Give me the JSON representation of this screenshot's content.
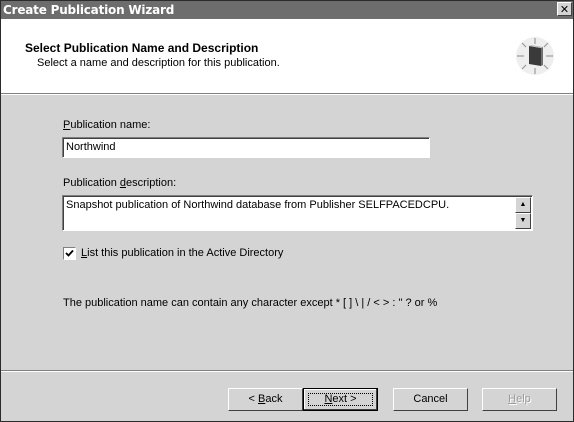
{
  "window": {
    "title": "Create Publication Wizard",
    "close_glyph": "✕"
  },
  "header": {
    "title": "Select Publication Name and Description",
    "subtitle": "Select a name and description for this publication.",
    "icon": "wizard-book-icon"
  },
  "form": {
    "name_label_accel": "P",
    "name_label_rest": "ublication name:",
    "name_value": "Northwind",
    "desc_label_pre": "Publication ",
    "desc_label_accel": "d",
    "desc_label_rest": "escription:",
    "desc_value": "Snapshot publication of Northwind database from Publisher SELFPACEDCPU.",
    "checkbox_accel": "L",
    "checkbox_rest": "ist this publication in the Active Directory",
    "checkbox_checked": true,
    "note": "The publication name can contain any character except * [ ] \\ | / < > : \" ? or %"
  },
  "buttons": {
    "back_pre": "< ",
    "back_accel": "B",
    "back_rest": "ack",
    "next_accel": "N",
    "next_rest": "ext >",
    "cancel": "Cancel",
    "help_accel": "H",
    "help_rest": "elp"
  }
}
